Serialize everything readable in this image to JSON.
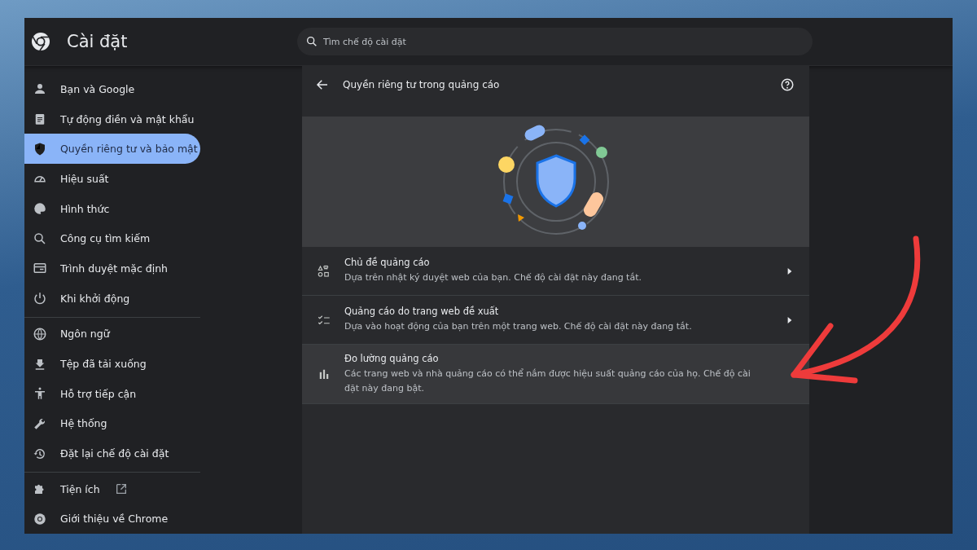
{
  "window": {
    "title": "Cài đặt"
  },
  "search": {
    "placeholder": "Tìm chế độ cài đặt"
  },
  "sidebar": {
    "groups": [
      {
        "items": [
          {
            "label": "Bạn và Google",
            "selected": false,
            "external": false
          },
          {
            "label": "Tự động điền và mật khẩu",
            "selected": false,
            "external": false
          },
          {
            "label": "Quyền riêng tư và bảo mật",
            "selected": true,
            "external": false
          },
          {
            "label": "Hiệu suất",
            "selected": false,
            "external": false
          },
          {
            "label": "Hình thức",
            "selected": false,
            "external": false
          },
          {
            "label": "Công cụ tìm kiếm",
            "selected": false,
            "external": false
          },
          {
            "label": "Trình duyệt mặc định",
            "selected": false,
            "external": false
          },
          {
            "label": "Khi khởi động",
            "selected": false,
            "external": false
          }
        ]
      },
      {
        "items": [
          {
            "label": "Ngôn ngữ",
            "selected": false,
            "external": false
          },
          {
            "label": "Tệp đã tải xuống",
            "selected": false,
            "external": false
          },
          {
            "label": "Hỗ trợ tiếp cận",
            "selected": false,
            "external": false
          },
          {
            "label": "Hệ thống",
            "selected": false,
            "external": false
          },
          {
            "label": "Đặt lại chế độ cài đặt",
            "selected": false,
            "external": false
          }
        ]
      },
      {
        "items": [
          {
            "label": "Tiện ích",
            "selected": false,
            "external": true
          },
          {
            "label": "Giới thiệu về Chrome",
            "selected": false,
            "external": false
          }
        ]
      }
    ]
  },
  "page": {
    "title": "Quyền riêng tư trong quảng cáo",
    "rows": [
      {
        "title": "Chủ đề quảng cáo",
        "description": "Dựa trên nhật ký duyệt web của bạn. Chế độ cài đặt này đang tắt.",
        "selected": false,
        "has_arrow": true
      },
      {
        "title": "Quảng cáo do trang web đề xuất",
        "description": "Dựa vào hoạt động của bạn trên một trang web. Chế độ cài đặt này đang tắt.",
        "selected": false,
        "has_arrow": true
      },
      {
        "title": "Đo lường quảng cáo",
        "description": "Các trang web và nhà quảng cáo có thể nắm được hiệu suất quảng cáo của họ. Chế độ cài đặt này đang bật.",
        "selected": true,
        "has_arrow": false
      }
    ]
  }
}
